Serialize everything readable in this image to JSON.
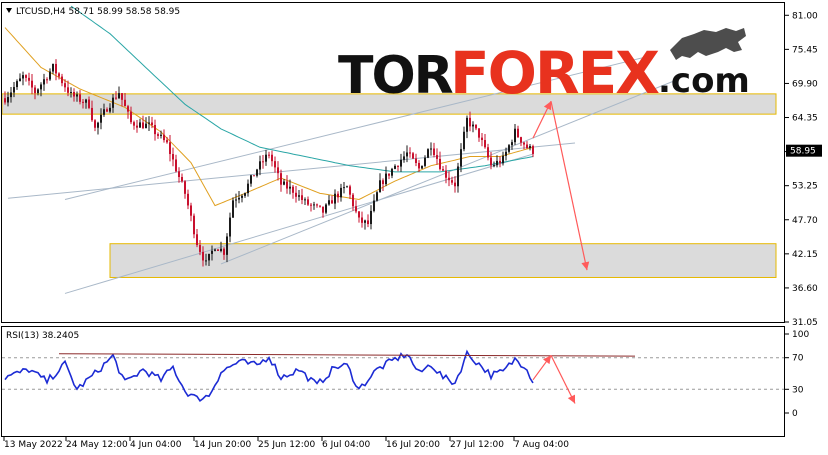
{
  "header": {
    "title": "LTCUSD,H4  58.71 58.99 58.58 58.95",
    "indicator": "RSI(13) 38.2405"
  },
  "logo": {
    "part1": "TOR",
    "part2": "FOREX",
    "part3": ".com"
  },
  "colors": {
    "bull": "#1a1a1a",
    "bear": "#c8102e",
    "ma_fast": "#e0a020",
    "ma_slow": "#2aa6a6",
    "trendline": "#a9b8c8",
    "zone_fill": "#d9d9d9",
    "zone_border": "#e6b800",
    "rsi": "#1c2bd4",
    "arrow": "#ff5a5a",
    "rsi_resistance": "#8b2a2a",
    "price_tag_bg": "#000000"
  },
  "chart_data": {
    "type": "candlestick",
    "title": "LTCUSD,H4",
    "ohlc_header": {
      "open": 58.71,
      "high": 58.99,
      "low": 58.58,
      "close": 58.95
    },
    "current_price": 58.95,
    "ylim": [
      31.05,
      83.0
    ],
    "y_ticks": [
      81.0,
      75.45,
      69.9,
      64.35,
      58.8,
      53.25,
      47.7,
      42.15,
      36.6,
      31.05
    ],
    "x_ticks": [
      "13 May 2022",
      "24 May 12:00",
      "4 Jun 04:00",
      "14 Jun 20:00",
      "25 Jun 12:00",
      "6 Jul 04:00",
      "16 Jul 20:00",
      "27 Jul 12:00",
      "7 Aug 04:00"
    ],
    "path_waypoints": [
      {
        "i": 0,
        "p": 67.5
      },
      {
        "i": 6,
        "p": 71.0
      },
      {
        "i": 10,
        "p": 68.5
      },
      {
        "i": 16,
        "p": 72.5
      },
      {
        "i": 22,
        "p": 68.0
      },
      {
        "i": 28,
        "p": 66.5
      },
      {
        "i": 30,
        "p": 62.5
      },
      {
        "i": 34,
        "p": 66.0
      },
      {
        "i": 38,
        "p": 68.5
      },
      {
        "i": 42,
        "p": 63.5
      },
      {
        "i": 48,
        "p": 63.0
      },
      {
        "i": 54,
        "p": 60.0
      },
      {
        "i": 60,
        "p": 52.0
      },
      {
        "i": 64,
        "p": 44.0
      },
      {
        "i": 67,
        "p": 40.5
      },
      {
        "i": 70,
        "p": 43.5
      },
      {
        "i": 73,
        "p": 42.5
      },
      {
        "i": 76,
        "p": 51.0
      },
      {
        "i": 80,
        "p": 52.5
      },
      {
        "i": 84,
        "p": 56.0
      },
      {
        "i": 88,
        "p": 58.5
      },
      {
        "i": 92,
        "p": 53.5
      },
      {
        "i": 96,
        "p": 52.5
      },
      {
        "i": 100,
        "p": 50.5
      },
      {
        "i": 106,
        "p": 49.0
      },
      {
        "i": 110,
        "p": 51.5
      },
      {
        "i": 114,
        "p": 53.0
      },
      {
        "i": 118,
        "p": 47.5
      },
      {
        "i": 121,
        "p": 47.0
      },
      {
        "i": 125,
        "p": 53.5
      },
      {
        "i": 130,
        "p": 56.5
      },
      {
        "i": 134,
        "p": 58.5
      },
      {
        "i": 138,
        "p": 56.0
      },
      {
        "i": 142,
        "p": 60.0
      },
      {
        "i": 146,
        "p": 55.5
      },
      {
        "i": 150,
        "p": 53.5
      },
      {
        "i": 154,
        "p": 64.0
      },
      {
        "i": 158,
        "p": 61.5
      },
      {
        "i": 162,
        "p": 56.5
      },
      {
        "i": 166,
        "p": 57.5
      },
      {
        "i": 170,
        "p": 62.0
      },
      {
        "i": 174,
        "p": 59.5
      },
      {
        "i": 176,
        "p": 58.95
      }
    ],
    "ma_fast_waypoints": [
      {
        "i": 0,
        "p": 79.0
      },
      {
        "i": 12,
        "p": 72.5
      },
      {
        "i": 25,
        "p": 69.0
      },
      {
        "i": 40,
        "p": 66.0
      },
      {
        "i": 52,
        "p": 62.0
      },
      {
        "i": 62,
        "p": 57.0
      },
      {
        "i": 70,
        "p": 50.0
      },
      {
        "i": 80,
        "p": 52.0
      },
      {
        "i": 92,
        "p": 54.5
      },
      {
        "i": 105,
        "p": 52.0
      },
      {
        "i": 118,
        "p": 51.0
      },
      {
        "i": 130,
        "p": 54.0
      },
      {
        "i": 142,
        "p": 56.5
      },
      {
        "i": 155,
        "p": 58.0
      },
      {
        "i": 165,
        "p": 58.0
      },
      {
        "i": 176,
        "p": 59.5
      }
    ],
    "ma_slow_waypoints": [
      {
        "i": 22,
        "p": 82.5
      },
      {
        "i": 35,
        "p": 78.0
      },
      {
        "i": 48,
        "p": 72.0
      },
      {
        "i": 60,
        "p": 66.5
      },
      {
        "i": 72,
        "p": 62.5
      },
      {
        "i": 85,
        "p": 59.5
      },
      {
        "i": 100,
        "p": 58.0
      },
      {
        "i": 115,
        "p": 56.5
      },
      {
        "i": 130,
        "p": 55.5
      },
      {
        "i": 145,
        "p": 55.5
      },
      {
        "i": 160,
        "p": 56.5
      },
      {
        "i": 176,
        "p": 58.0
      }
    ],
    "zones": [
      {
        "name": "resistance zone",
        "top": 68.2,
        "bottom": 64.9
      },
      {
        "name": "support zone",
        "top": 43.8,
        "bottom": 38.3
      }
    ],
    "trendlines": [
      {
        "p1": {
          "i": 1,
          "p": 51.2
        },
        "p2": {
          "i": 190,
          "p": 60.2
        }
      },
      {
        "p1": {
          "i": 20,
          "p": 35.7
        },
        "p2": {
          "i": 176,
          "p": 58.4
        }
      },
      {
        "p1": {
          "i": 72,
          "p": 40.5
        },
        "p2": {
          "i": 224,
          "p": 70.5
        }
      },
      {
        "p1": {
          "i": 20,
          "p": 51.0
        },
        "p2": {
          "i": 216,
          "p": 74.5
        }
      }
    ],
    "forecast_arrows": [
      {
        "from": {
          "i": 176,
          "p": 61.0
        },
        "to": {
          "i": 182,
          "p": 67.0
        }
      },
      {
        "from": {
          "i": 182,
          "p": 67.0
        },
        "to": {
          "i": 194,
          "p": 39.5
        }
      }
    ],
    "rsi": {
      "label": "RSI(13)",
      "value": 38.2405,
      "ylim": [
        0,
        100
      ],
      "y_ticks": [
        100,
        70,
        30,
        0
      ],
      "levels": [
        70,
        30
      ],
      "waypoints": [
        {
          "i": 0,
          "p": 45
        },
        {
          "i": 8,
          "p": 55
        },
        {
          "i": 14,
          "p": 40
        },
        {
          "i": 20,
          "p": 62
        },
        {
          "i": 24,
          "p": 30
        },
        {
          "i": 30,
          "p": 50
        },
        {
          "i": 36,
          "p": 72
        },
        {
          "i": 40,
          "p": 38
        },
        {
          "i": 46,
          "p": 55
        },
        {
          "i": 52,
          "p": 42
        },
        {
          "i": 56,
          "p": 58
        },
        {
          "i": 60,
          "p": 28
        },
        {
          "i": 64,
          "p": 18
        },
        {
          "i": 68,
          "p": 22
        },
        {
          "i": 72,
          "p": 52
        },
        {
          "i": 78,
          "p": 65
        },
        {
          "i": 84,
          "p": 60
        },
        {
          "i": 88,
          "p": 72
        },
        {
          "i": 92,
          "p": 45
        },
        {
          "i": 98,
          "p": 55
        },
        {
          "i": 104,
          "p": 35
        },
        {
          "i": 110,
          "p": 58
        },
        {
          "i": 114,
          "p": 60
        },
        {
          "i": 118,
          "p": 30
        },
        {
          "i": 124,
          "p": 55
        },
        {
          "i": 130,
          "p": 68
        },
        {
          "i": 134,
          "p": 75
        },
        {
          "i": 138,
          "p": 50
        },
        {
          "i": 142,
          "p": 62
        },
        {
          "i": 146,
          "p": 45
        },
        {
          "i": 150,
          "p": 38
        },
        {
          "i": 154,
          "p": 75
        },
        {
          "i": 158,
          "p": 62
        },
        {
          "i": 162,
          "p": 48
        },
        {
          "i": 166,
          "p": 52
        },
        {
          "i": 170,
          "p": 68
        },
        {
          "i": 174,
          "p": 58
        },
        {
          "i": 176,
          "p": 38
        }
      ],
      "resistance_line": {
        "p1": {
          "i": 18,
          "p": 75
        },
        "p2": {
          "i": 210,
          "p": 72
        }
      },
      "forecast_arrows": [
        {
          "from": {
            "i": 176,
            "p": 42
          },
          "to": {
            "i": 182,
            "p": 73
          }
        },
        {
          "from": {
            "i": 182,
            "p": 73
          },
          "to": {
            "i": 190,
            "p": 12
          }
        }
      ]
    }
  }
}
